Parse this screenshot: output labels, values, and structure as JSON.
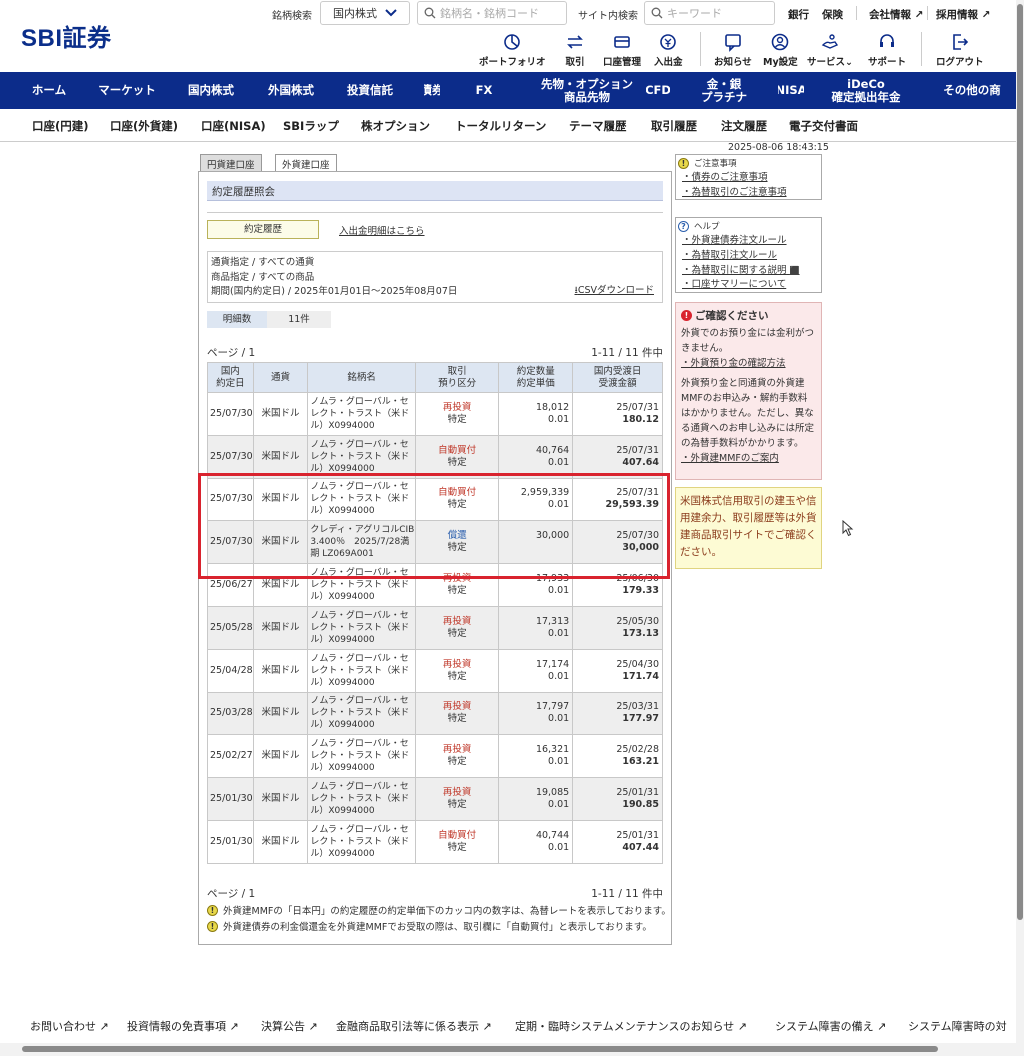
{
  "header": {
    "logo": "SBI証券",
    "stock_search_label": "銘柄検索",
    "market_select": "国内株式",
    "stock_search_placeholder": "銘柄名・銘柄コード",
    "site_search_label": "サイト内検索",
    "site_search_placeholder": "キーワード",
    "top_links": [
      "銀行",
      "保険",
      "会社情報",
      "採用情報"
    ],
    "icons": [
      {
        "label": "ポートフォリオ",
        "icon": "portfolio-icon"
      },
      {
        "label": "取引",
        "icon": "trade-icon"
      },
      {
        "label": "口座管理",
        "icon": "account-icon"
      },
      {
        "label": "入出金",
        "icon": "deposit-icon"
      },
      {
        "label": "お知らせ",
        "icon": "notice-icon"
      },
      {
        "label": "My設定",
        "icon": "user-icon"
      },
      {
        "label": "サービス",
        "icon": "service-icon"
      },
      {
        "label": "サポート",
        "icon": "support-icon"
      },
      {
        "label": "ログアウト",
        "icon": "logout-icon"
      }
    ]
  },
  "global_nav": [
    "ホーム",
    "マーケット",
    "国内株式",
    "外国株式",
    "投資信託",
    "債券",
    "FX",
    "先物・オプション\n商品先物",
    "CFD",
    "金・銀\nプラチナ",
    "NISA",
    "iDeCo\n確定拠出年金",
    "その他の商"
  ],
  "sub_nav": [
    "口座(円建)",
    "口座(外貨建)",
    "口座(NISA)",
    "SBIラップ",
    "株オプション",
    "トータルリターン",
    "テーマ履歴",
    "取引履歴",
    "注文履歴",
    "電子交付書面"
  ],
  "timestamp": "2025-08-06 18:43:15",
  "tabs": [
    "円貨建口座",
    "外貨建口座"
  ],
  "panel_title": "約定履歴照会",
  "trade_history_button": "約定履歴",
  "deposit_link": "入出金明細はこちら",
  "filters": {
    "currency": "通貨指定 / すべての通貨",
    "product": "商品指定 / すべての商品",
    "period": "期間(国内約定日) / 2025年01月01日～2025年08月07日",
    "csv": "CSVダウンロード"
  },
  "count": {
    "label": "明細数",
    "value": "11件"
  },
  "pager": {
    "page": "ページ / 1",
    "range": "1-11 / 11 件中"
  },
  "table": {
    "headers": [
      "国内\n約定日",
      "通貨",
      "銘柄名",
      "取引\n預り区分",
      "約定数量\n約定単価",
      "国内受渡日\n受渡金額"
    ],
    "rows": [
      {
        "date": "25/07/30",
        "currency": "米国ドル",
        "name": "ノムラ・グローバル・セレクト・トラスト（米ドル）X0994000",
        "type": "再投資",
        "account": "特定",
        "qty": "18,012",
        "price": "0.01",
        "settle_date": "25/07/31",
        "amount": "180.12"
      },
      {
        "date": "25/07/30",
        "currency": "米国ドル",
        "name": "ノムラ・グローバル・セレクト・トラスト（米ドル）X0994000",
        "type": "自動買付",
        "account": "特定",
        "qty": "40,764",
        "price": "0.01",
        "settle_date": "25/07/31",
        "amount": "407.64"
      },
      {
        "date": "25/07/30",
        "currency": "米国ドル",
        "name": "ノムラ・グローバル・セレクト・トラスト（米ドル）X0994000",
        "type": "自動買付",
        "account": "特定",
        "qty": "2,959,339",
        "price": "0.01",
        "settle_date": "25/07/31",
        "amount": "29,593.39"
      },
      {
        "date": "25/07/30",
        "currency": "米国ドル",
        "name": "クレディ・アグリコルCIB 3.400％　2025/7/28満期 LZ069A001",
        "type": "償還",
        "account": "特定",
        "qty": "30,000",
        "price": "",
        "settle_date": "25/07/30",
        "amount": "30,000"
      },
      {
        "date": "25/06/27",
        "currency": "米国ドル",
        "name": "ノムラ・グローバル・セレクト・トラスト（米ドル）X0994000",
        "type": "再投資",
        "account": "特定",
        "qty": "17,933",
        "price": "0.01",
        "settle_date": "25/06/30",
        "amount": "179.33"
      },
      {
        "date": "25/05/28",
        "currency": "米国ドル",
        "name": "ノムラ・グローバル・セレクト・トラスト（米ドル）X0994000",
        "type": "再投資",
        "account": "特定",
        "qty": "17,313",
        "price": "0.01",
        "settle_date": "25/05/30",
        "amount": "173.13"
      },
      {
        "date": "25/04/28",
        "currency": "米国ドル",
        "name": "ノムラ・グローバル・セレクト・トラスト（米ドル）X0994000",
        "type": "再投資",
        "account": "特定",
        "qty": "17,174",
        "price": "0.01",
        "settle_date": "25/04/30",
        "amount": "171.74"
      },
      {
        "date": "25/03/28",
        "currency": "米国ドル",
        "name": "ノムラ・グローバル・セレクト・トラスト（米ドル）X0994000",
        "type": "再投資",
        "account": "特定",
        "qty": "17,797",
        "price": "0.01",
        "settle_date": "25/03/31",
        "amount": "177.97"
      },
      {
        "date": "25/02/27",
        "currency": "米国ドル",
        "name": "ノムラ・グローバル・セレクト・トラスト（米ドル）X0994000",
        "type": "再投資",
        "account": "特定",
        "qty": "16,321",
        "price": "0.01",
        "settle_date": "25/02/28",
        "amount": "163.21"
      },
      {
        "date": "25/01/30",
        "currency": "米国ドル",
        "name": "ノムラ・グローバル・セレクト・トラスト（米ドル）X0994000",
        "type": "再投資",
        "account": "特定",
        "qty": "19,085",
        "price": "0.01",
        "settle_date": "25/01/31",
        "amount": "190.85"
      },
      {
        "date": "25/01/30",
        "currency": "米国ドル",
        "name": "ノムラ・グローバル・セレクト・トラスト（米ドル）X0994000",
        "type": "自動買付",
        "account": "特定",
        "qty": "40,744",
        "price": "0.01",
        "settle_date": "25/01/31",
        "amount": "407.44"
      }
    ]
  },
  "notes": [
    "外貨建MMFの「日本円」の約定履歴の約定単価下のカッコ内の数字は、為替レートを表示しております。",
    "外貨建債券の利金償還金を外貨建MMFでお受取の際は、取引欄に「自動買付」と表示しております。"
  ],
  "sidebar": {
    "caution_title": "ご注意事項",
    "caution_links": [
      "債券のご注意事項",
      "為替取引のご注意事項"
    ],
    "help_title": "ヘルプ",
    "help_links": [
      "外貨建債券注文ルール",
      "為替取引注文ルール",
      "為替取引に関する説明",
      "口座サマリーについて"
    ],
    "confirm_title": "ご確認ください",
    "confirm_text1": "外貨でのお預り金には金利がつきません。",
    "confirm_link1": "外貨預り金の確認方法",
    "confirm_text2": "外貨預り金と同通貨の外貨建MMFのお申込み・解約手数料はかかりません。ただし、異なる通貨へのお申し込みには所定の為替手数料がかかります。",
    "confirm_link2": "外貨建MMFのご案内",
    "notice": "米国株式信用取引の建玉や信用建余力、取引履歴等は外貨建商品取引サイトでご確認ください。"
  },
  "footer": [
    "お問い合わせ",
    "投資情報の免責事項",
    "決算公告",
    "金融商品取引法等に係る表示",
    "定期・臨時システムメンテナンスのお知らせ",
    "システム障害の備え",
    "システム障害時の対"
  ],
  "colors": {
    "navy": "#0c2c8a",
    "highlight": "#d9232e",
    "header_bg": "#dde6f2"
  }
}
